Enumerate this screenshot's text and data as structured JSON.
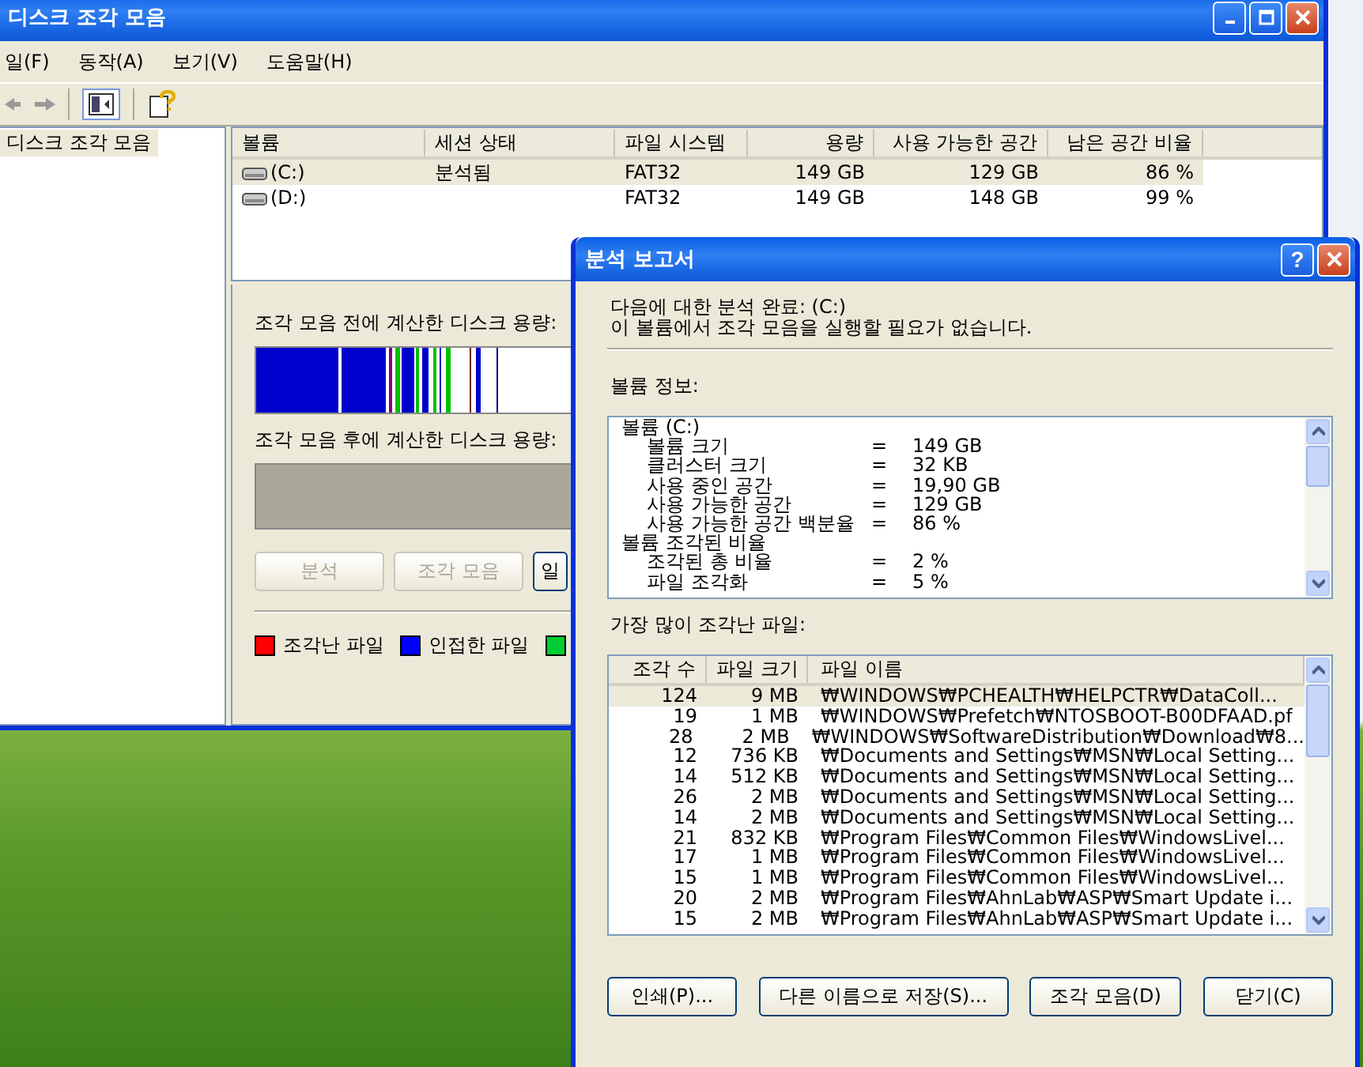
{
  "main_window": {
    "title": "디스크 조각 모음",
    "menu": [
      "일(F)",
      "동작(A)",
      "보기(V)",
      "도움말(H)"
    ],
    "tree": [
      {
        "label": "디스크 조각 모음",
        "selected": true
      }
    ],
    "volumes": {
      "columns": [
        "볼륨",
        "세션 상태",
        "파일 시스템",
        "용량",
        "사용 가능한 공간",
        "남은 공간 비율"
      ],
      "rows": [
        {
          "volume": "(C:)",
          "status": "분석됨",
          "fs": "FAT32",
          "capacity": "149 GB",
          "free": "129 GB",
          "percent": "86 %",
          "selected": true
        },
        {
          "volume": "(D:)",
          "fs": "FAT32",
          "capacity": "149 GB",
          "free": "148 GB",
          "percent": "99 %",
          "selected": false
        }
      ]
    },
    "before_label": "조각 모음 전에 계산한 디스크 용량:",
    "after_label": "조각 모음 후에 계산한 디스크 용량:",
    "buttons": [
      {
        "label": "분석",
        "disabled": true
      },
      {
        "label": "조각 모음",
        "disabled": true
      },
      {
        "label": "일",
        "disabled": false
      }
    ],
    "legend": [
      {
        "label": "조각난 파일",
        "color": "#ff0000"
      },
      {
        "label": "인접한 파일",
        "color": "#0000ff"
      },
      {
        "color": "#00cc33"
      }
    ]
  },
  "dialog": {
    "title": "분석 보고서",
    "help_button": "?",
    "message": [
      "다음에 대한 분석 완료: (C:)",
      "이 볼륨에서 조각 모음을 실행할 필요가 없습니다."
    ],
    "info_label": "볼륨 정보:",
    "info": [
      {
        "label": "볼륨  (C:)",
        "children": [
          {
            "label": "볼륨 크기",
            "equals": "=",
            "value": "149 GB"
          },
          {
            "label": "클러스터 크기",
            "equals": "=",
            "value": "32 KB"
          },
          {
            "label": "사용 중인 공간",
            "equals": "=",
            "value": "19,90 GB"
          },
          {
            "label": "사용 가능한 공간",
            "equals": "=",
            "value": "129 GB"
          },
          {
            "label": "사용 가능한 공간 백분율",
            "equals": "=",
            "value": "86 %"
          }
        ]
      },
      {
        "label": "볼륨 조각된 비율",
        "children": [
          {
            "label": "조각된 총 비율",
            "equals": "=",
            "value": "2 %"
          },
          {
            "label": "파일 조각화",
            "equals": "=",
            "value": "5 %"
          }
        ]
      }
    ],
    "files_label": "가장 많이 조각난 파일:",
    "files": {
      "columns": [
        "조각 수",
        "파일 크기",
        "파일 이름"
      ],
      "rows": [
        {
          "fragments": "124",
          "size": "9 MB",
          "name": "₩WINDOWS₩PCHEALTH₩HELPCTR₩DataColl...",
          "selected": true
        },
        {
          "fragments": "19",
          "size": "1 MB",
          "name": "₩WINDOWS₩Prefetch₩NTOSBOOT-B00DFAAD.pf",
          "selected": false
        },
        {
          "fragments": "28",
          "size": "2 MB",
          "name": "₩WINDOWS₩SoftwareDistribution₩Download₩8...",
          "selected": false
        },
        {
          "fragments": "12",
          "size": "736 KB",
          "name": "₩Documents and Settings₩MSN₩Local Setting...",
          "selected": false
        },
        {
          "fragments": "14",
          "size": "512 KB",
          "name": "₩Documents and Settings₩MSN₩Local Setting...",
          "selected": false
        },
        {
          "fragments": "26",
          "size": "2 MB",
          "name": "₩Documents and Settings₩MSN₩Local Setting...",
          "selected": false
        },
        {
          "fragments": "14",
          "size": "2 MB",
          "name": "₩Documents and Settings₩MSN₩Local Setting...",
          "selected": false
        },
        {
          "fragments": "21",
          "size": "832 KB",
          "name": "₩Program Files₩Common Files₩WindowsLivel...",
          "selected": false
        },
        {
          "fragments": "17",
          "size": "1 MB",
          "name": "₩Program Files₩Common Files₩WindowsLivel...",
          "selected": false
        },
        {
          "fragments": "15",
          "size": "1 MB",
          "name": "₩Program Files₩Common Files₩WindowsLivel...",
          "selected": false
        },
        {
          "fragments": "20",
          "size": "2 MB",
          "name": "₩Program Files₩AhnLab₩ASP₩Smart Update i...",
          "selected": false
        },
        {
          "fragments": "15",
          "size": "2 MB",
          "name": "₩Program Files₩AhnLab₩ASP₩Smart Update i...",
          "selected": false
        }
      ]
    },
    "buttons": [
      "인쇄(P)...",
      "다른 이름으로 저장(S)...",
      "조각 모음(D)",
      "닫기(C)"
    ]
  }
}
